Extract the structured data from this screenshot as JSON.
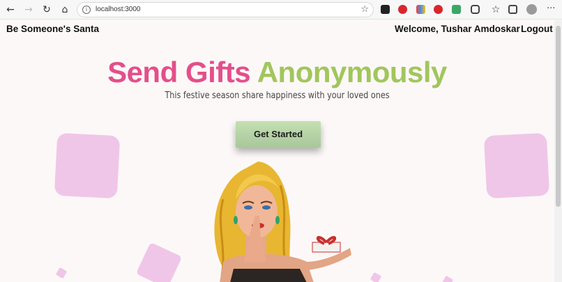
{
  "browser": {
    "url": "localhost:3000"
  },
  "header": {
    "brand": "Be Someone's Santa",
    "welcome": "Welcome, Tushar Amdoskar",
    "logout": "Logout"
  },
  "hero": {
    "title_part1": "Send Gifts",
    "title_part2": "Anonymously",
    "subtitle": "This festive season share happiness with your loved ones",
    "cta": "Get Started"
  },
  "colors": {
    "title_pink": "#e34f8a",
    "title_green": "#a1c65c",
    "button": "#b5d4a4",
    "shapes": "#f0c6e8"
  }
}
